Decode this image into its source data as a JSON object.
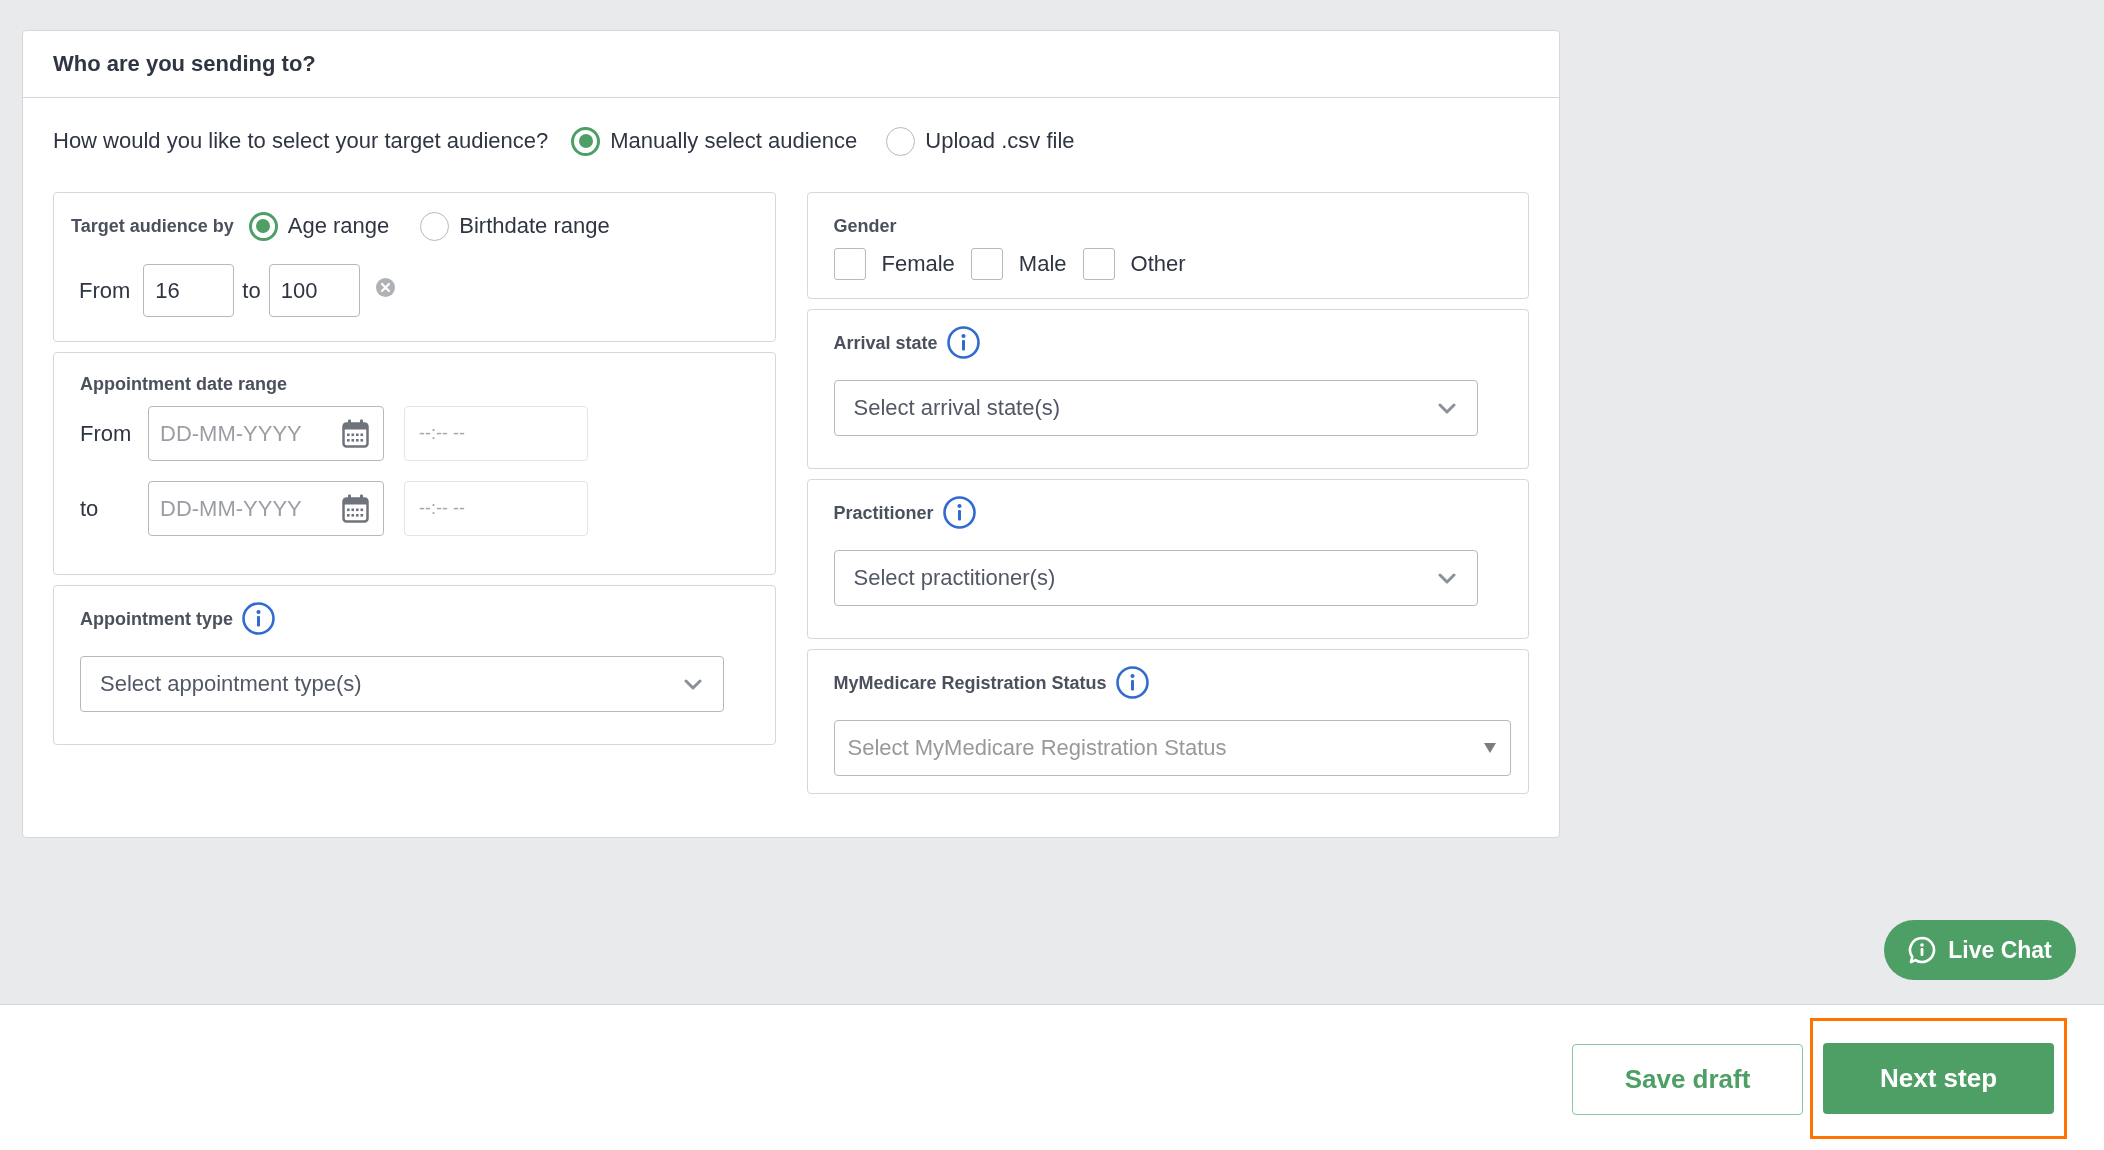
{
  "header": {
    "title": "Who are you sending to?"
  },
  "audience_method": {
    "question": "How would you like to select your target audience?",
    "options": [
      {
        "label": "Manually select audience",
        "selected": true
      },
      {
        "label": "Upload .csv file",
        "selected": false
      }
    ]
  },
  "left_panels": [
    {
      "kind": "age_range",
      "label": "Target audience by",
      "options": [
        {
          "label": "Age range",
          "selected": true
        },
        {
          "label": "Birthdate range",
          "selected": false
        }
      ],
      "from_label": "From",
      "from_value": "16",
      "to_label": "to",
      "to_value": "100"
    },
    {
      "kind": "date_range",
      "label": "Appointment date range",
      "rows": [
        {
          "label": "From",
          "date": {
            "placeholder": "DD-MM-YYYY",
            "disabled": false
          },
          "time": {
            "placeholder": "--:-- --",
            "disabled": true
          }
        },
        {
          "label": "to",
          "date": {
            "placeholder": "DD-MM-YYYY",
            "disabled": false
          },
          "time": {
            "placeholder": "--:-- --",
            "disabled": true
          }
        }
      ]
    },
    {
      "kind": "multiselect",
      "label": "Appointment type",
      "info_icon": true,
      "placeholder": "Select appointment type(s)"
    }
  ],
  "right_panels": [
    {
      "kind": "checkboxes",
      "label": "Gender",
      "options": [
        {
          "label": "Female",
          "checked": false
        },
        {
          "label": "Male",
          "checked": false
        },
        {
          "label": "Other",
          "checked": false
        }
      ]
    },
    {
      "kind": "multiselect",
      "label": "Arrival state",
      "info_icon": true,
      "placeholder": "Select arrival state(s)"
    },
    {
      "kind": "multiselect",
      "label": "Practitioner",
      "info_icon": true,
      "placeholder": "Select practitioner(s)"
    },
    {
      "kind": "dropdown",
      "label": "MyMedicare Registration Status",
      "info_icon": true,
      "placeholder": "Select MyMedicare Registration Status"
    }
  ],
  "live_chat": {
    "label": "Live Chat"
  },
  "footer": {
    "buttons": [
      {
        "label": "Save draft",
        "kind": "secondary",
        "highlighted": false
      },
      {
        "label": "Next step",
        "kind": "primary",
        "highlighted": true
      }
    ]
  }
}
